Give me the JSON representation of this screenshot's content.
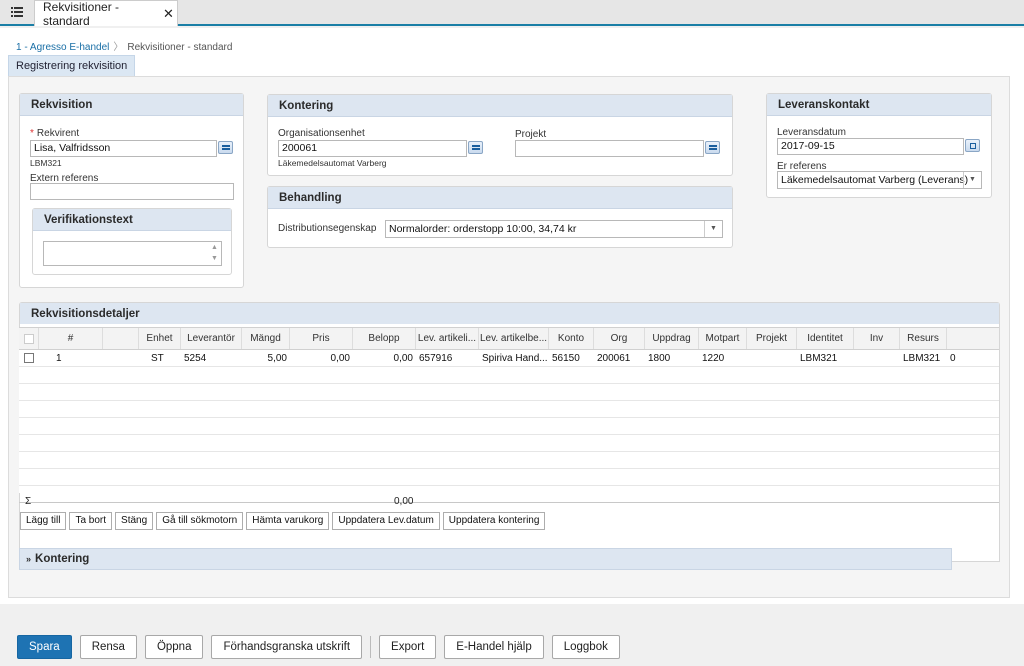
{
  "window": {
    "tab_title": "Rekvisitioner - standard",
    "close_glyph": "✕"
  },
  "breadcrumb": {
    "items": [
      "1 - Agresso E-handel",
      "Rekvisitioner - standard"
    ]
  },
  "page_tab": "Registrering rekvisition",
  "rekvisition": {
    "title": "Rekvisition",
    "rekvirent_label": "Rekvirent",
    "rekvirent_value": "Lisa, Valfridsson",
    "rekvirent_sub": "LBM321",
    "extern_ref_label": "Extern referens",
    "extern_ref_value": "",
    "verif_title": "Verifikationstext",
    "verif_value": ""
  },
  "kontering": {
    "title": "Kontering",
    "org_label": "Organisationsenhet",
    "org_value": "200061",
    "org_sub": "Läkemedelsautomat Varberg",
    "projekt_label": "Projekt",
    "projekt_value": ""
  },
  "behandling": {
    "title": "Behandling",
    "dist_label": "Distributionsegenskap",
    "dist_value": "Normalorder: orderstopp 10:00, 34,74 kr"
  },
  "leverans": {
    "title": "Leveranskontakt",
    "date_label": "Leveransdatum",
    "date_value": "2017-09-15",
    "ref_label": "Er referens",
    "ref_value": "Läkemedelsautomat Varberg (Leverans)"
  },
  "details": {
    "title": "Rekvisitionsdetaljer",
    "columns": [
      "#",
      "Enhet",
      "Leverantör",
      "Mängd",
      "Pris",
      "Belopp",
      "Lev. artikeli...",
      "Lev. artikelbe...",
      "Konto",
      "Org",
      "Uppdrag",
      "Motpart",
      "Projekt",
      "Identitet",
      "Inv",
      "Resurs"
    ],
    "rows": [
      [
        "1",
        "",
        "ST",
        "5254",
        "5,00",
        "0,00",
        "0,00",
        "657916",
        "Spiriva Hand...",
        "56150",
        "200061",
        "1800",
        "1220",
        "",
        "LBM321",
        "",
        "LBM321",
        "0"
      ]
    ],
    "sum_symbol": "Σ",
    "sum_belopp": "0,00",
    "buttons": [
      "Lägg till",
      "Ta bort",
      "Stäng",
      "Gå till sökmotorn",
      "Hämta varukorg",
      "Uppdatera Lev.datum",
      "Uppdatera kontering"
    ]
  },
  "kontering_collapsed": {
    "title": "Kontering",
    "chevron": "»"
  },
  "footer": {
    "buttons": [
      "Spara",
      "Rensa",
      "Öppna",
      "Förhandsgranska utskrift",
      "Export",
      "E-Handel hjälp",
      "Loggbok"
    ]
  },
  "colors": {
    "accent": "#1e73b3",
    "panel_header": "#dde6f1",
    "tab_underline": "#1a7fa6"
  },
  "icons": [
    "list-menu-icon",
    "close-icon",
    "lookup-icon",
    "calendar-icon",
    "dropdown-arrow-icon",
    "spinner-icon",
    "collapse-chevron-icon"
  ]
}
